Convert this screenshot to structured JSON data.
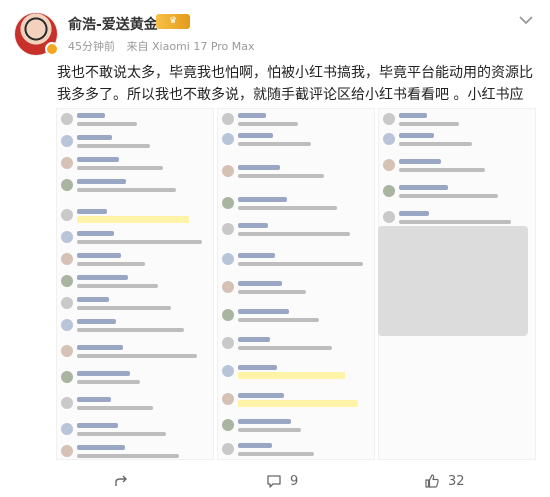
{
  "post": {
    "author": "俞浩-爱送黄金",
    "badge": "",
    "time": "45分钟前",
    "source": "来自 Xiaomi 17 Pro Max",
    "text": "我也不敢说太多，毕竟我也怕啊，怕被小红书搞我，毕竟平台能动用的资源比我多多了。所以我也不敢多说，就随手截评论区给小红书看看吧 。小红书应该正视!"
  },
  "actions": {
    "share_icon": "share-icon",
    "comment_icon": "comment-icon",
    "comment_count": "9",
    "like_icon": "like-icon",
    "like_count": "32"
  },
  "colors": {
    "accent": "#f5a623",
    "link": "#5b7bb5",
    "text": "#222222",
    "meta": "#999999"
  }
}
